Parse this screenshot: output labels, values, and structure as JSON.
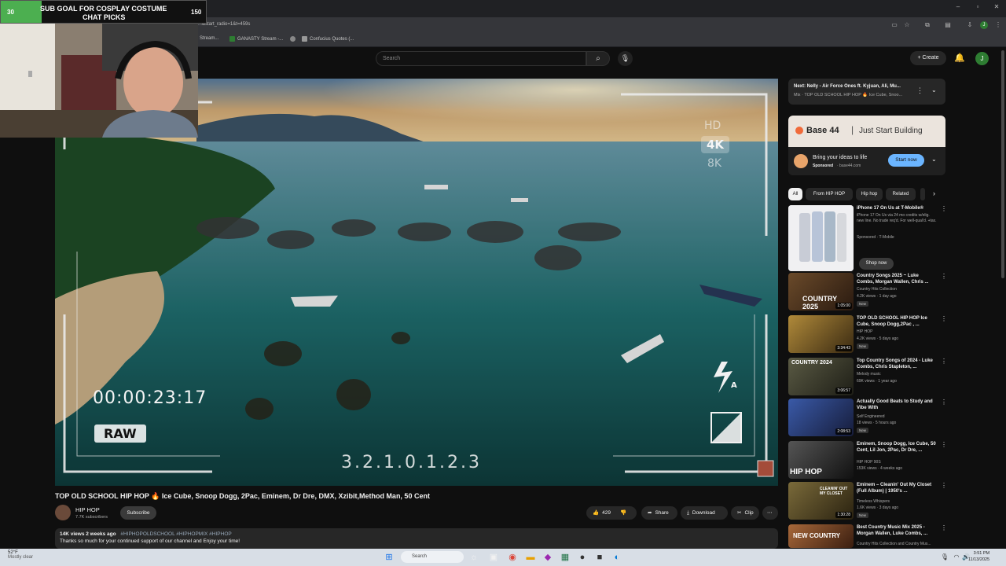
{
  "browser": {
    "url": "...&start_radio=1&t=459s",
    "bookmarks": [
      "Stream...",
      "GANASTY Stream -...",
      "",
      "Confucius Quotes (..."
    ]
  },
  "overlay": {
    "sub_goal_label": "SUB GOAL FOR COSPLAY COSTUME",
    "sub_goal_label2": "CHAT PICKS",
    "current": "30",
    "target": "150",
    "progress_fraction": 0.2
  },
  "header": {
    "search_placeholder": "Search",
    "create_label": "Create",
    "avatar_letter": "J"
  },
  "video": {
    "timecode": "00:00:23:17",
    "raw_label": "RAW",
    "res_hd": "HD",
    "res_4k": "4K",
    "res_8k": "8K",
    "scale": "3.2.1.0.1.2.3",
    "flash_label": "A"
  },
  "meta": {
    "title": "TOP OLD SCHOOL HIP HOP 🔥 Ice Cube, Snoop Dogg, 2Pac, Eminem, Dr Dre, DMX, Xzibit,Method Man, 50 Cent",
    "channel": "HIP HOP",
    "subscribers": "7.7K subscribers",
    "subscribe": "Subscribe",
    "likes": "429",
    "share": "Share",
    "download": "Download",
    "clip": "Clip",
    "views_date": "14K views  2 weeks ago",
    "hashtags": "#HIPHOPOLDSCHOOL #HIPHOPMIX #HIPHOP",
    "description": "Thanks so much for your continued support of our channel and Enjoy your time!"
  },
  "next": {
    "line1": "Next: Nelly - Air Force Ones ft. Kyjuan, Ali, Mu...",
    "line2": "Mix · TOP OLD SCHOOL HIP HOP 🔥 Ice Cube, Snoo..."
  },
  "ad": {
    "brand": "Base 44",
    "tagline": "Just Start Building",
    "headline": "Bring your ideas to life",
    "sponsor": "Sponsored",
    "domain": "· base44.com",
    "cta": "Start now"
  },
  "chips": [
    "All",
    "From HIP HOP",
    "Hip hop",
    "Related"
  ],
  "recommendations": [
    {
      "title": "iPhone 17 On Us at T-Mobile®",
      "sub1": "iPhone 17 On Us via 24 mo credits w/elig. new line. No trade req'd. For well-qual'd. +tax.",
      "sub2": "Sponsored · T-Mobile",
      "cta": "Shop now",
      "color": "#d9dde6"
    },
    {
      "title": "Country Songs 2025 ~ Luke Combs, Morgan Wallen, Chris ...",
      "channel": "Country Hits Collection",
      "meta": "4.2K views · 1 day ago",
      "badge": "New",
      "duration": "1:05:00",
      "color": "#5a3a22",
      "thumb_text": "COUNTRY 2025"
    },
    {
      "title": "TOP OLD SCHOOL HIP HOP Ice Cube, Snoop Dogg,2Pac , ...",
      "channel": "HIP HOP",
      "meta": "4.2K views · 5 days ago",
      "badge": "New",
      "duration": "3:34:43",
      "color": "#8a6a2a",
      "thumb_text": ""
    },
    {
      "title": "Top Country Songs of 2024 - Luke Combs, Chris Stapleton, ...",
      "channel": "Melody music",
      "meta": "69K views · 1 year ago",
      "badge": "",
      "duration": "3:06:57",
      "color": "#4a4a3a",
      "thumb_text": "COUNTRY 2024"
    },
    {
      "title": "Actually Good Beats to Study and Vibe With",
      "channel": "Self Engineered",
      "meta": "18 views · 5 hours ago",
      "badge": "New",
      "duration": "2:08:53",
      "color": "#2a3a7a",
      "thumb_text": ""
    },
    {
      "title": "Eminem, Snoop Dogg, Ice Cube, 50 Cent, Lil Jon, 2Pac, Dr Dre, ...",
      "channel": "HIP HOP 90S",
      "meta": "153K views · 4 weeks ago",
      "badge": "",
      "duration": "",
      "color": "#3a3a3a",
      "thumb_text": "HIP HOP"
    },
    {
      "title": "Eminem – Cleanin' Out My Closet (Full Album) | 1950's ...",
      "channel": "Timeless Whispers",
      "meta": "1.6K views · 3 days ago",
      "badge": "New",
      "duration": "1:30:28",
      "color": "#5a4a2a",
      "thumb_text": "CLEANIN' OUT MY CLOSET"
    },
    {
      "title": "Best Country Music Mix 2025 - Morgan Wallen, Luke Combs, ...",
      "channel": "Country Hits Collection and Country Mus...",
      "meta": "",
      "badge": "",
      "duration": "",
      "color": "#7a4a2a",
      "thumb_text": "NEW COUNTRY"
    }
  ],
  "taskbar": {
    "temp": "52°F",
    "weather": "Mostly clear",
    "search": "Search",
    "time": "3:51 PM",
    "date": "11/13/2025"
  }
}
